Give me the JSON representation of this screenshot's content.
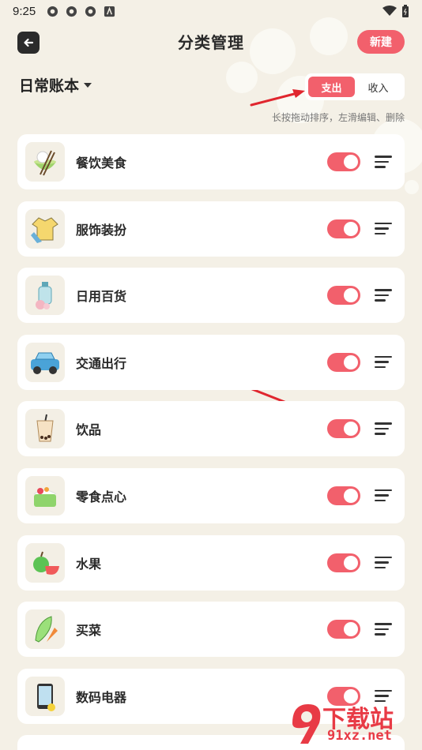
{
  "status": {
    "time": "9:25"
  },
  "header": {
    "title": "分类管理",
    "new_label": "新建"
  },
  "book": {
    "name": "日常账本"
  },
  "type_switch": {
    "expense": "支出",
    "income": "收入",
    "selected": "支出"
  },
  "hint": "长按拖动排序，左滑编辑、删除",
  "categories": [
    {
      "label": "餐饮美食",
      "icon": "rice-bowl-icon",
      "enabled": true
    },
    {
      "label": "服饰装扮",
      "icon": "shirt-icon",
      "enabled": true
    },
    {
      "label": "日用百货",
      "icon": "bottle-icon",
      "enabled": true
    },
    {
      "label": "交通出行",
      "icon": "car-icon",
      "enabled": true
    },
    {
      "label": "饮品",
      "icon": "bubble-tea-icon",
      "enabled": true
    },
    {
      "label": "零食点心",
      "icon": "cake-icon",
      "enabled": true
    },
    {
      "label": "水果",
      "icon": "fruit-icon",
      "enabled": true
    },
    {
      "label": "买菜",
      "icon": "vegetable-icon",
      "enabled": true
    },
    {
      "label": "数码电器",
      "icon": "phone-icon",
      "enabled": true
    }
  ],
  "watermark": {
    "text": "下载站",
    "url": "91xz.net"
  },
  "colors": {
    "accent": "#f2606c",
    "background": "#f4f0e6",
    "card": "#ffffff",
    "arrow": "#e0262e"
  }
}
